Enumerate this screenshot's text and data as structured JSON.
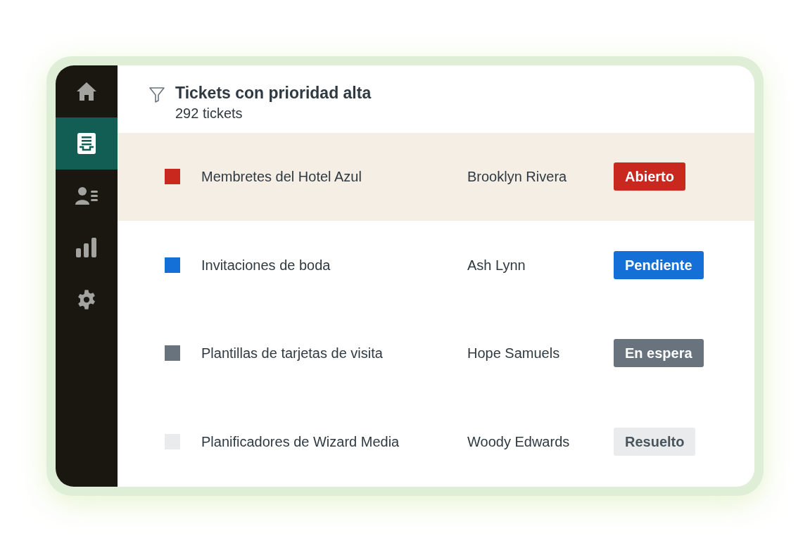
{
  "sidebar": {
    "items": [
      {
        "kind": "home",
        "selected": false
      },
      {
        "kind": "inbox",
        "selected": true
      },
      {
        "kind": "contacts",
        "selected": false
      },
      {
        "kind": "reports",
        "selected": false
      },
      {
        "kind": "settings",
        "selected": false
      }
    ]
  },
  "header": {
    "title": "Tickets con prioridad alta",
    "count": "292 tickets"
  },
  "rows": [
    {
      "name": "Membretes del Hotel Azul",
      "assignee": "Brooklyn Rivera",
      "status": "Abierto",
      "kind": "open",
      "color": "#c8281e",
      "selected": true
    },
    {
      "name": "Invitaciones de boda",
      "assignee": "Ash Lynn",
      "status": "Pendiente",
      "kind": "pending",
      "color": "#1470d6",
      "selected": false
    },
    {
      "name": "Plantillas de tarjetas de visita",
      "assignee": "Hope Samuels",
      "status": "En espera",
      "kind": "hold",
      "color": "#68737d",
      "selected": false
    },
    {
      "name": "Planificadores de Wizard Media",
      "assignee": "Woody Edwards",
      "status": "Resuelto",
      "kind": "resolved",
      "color": "#e9ebed",
      "selected": false
    }
  ]
}
